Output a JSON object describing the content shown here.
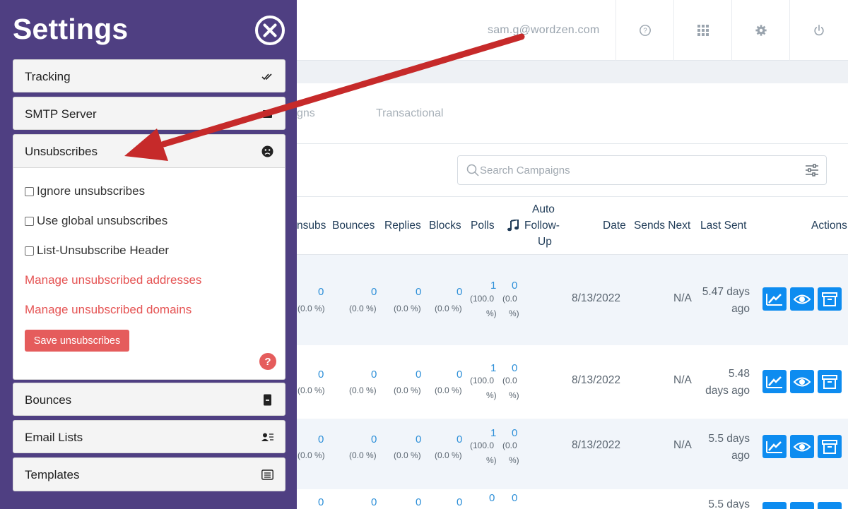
{
  "topbar": {
    "user_email": "sam.g@wordzen.com",
    "icons": [
      "help-icon",
      "apps-grid-icon",
      "gear-icon",
      "power-icon"
    ]
  },
  "tabs": {
    "partial_label": "gns",
    "transactional_label": "Transactional"
  },
  "search": {
    "placeholder": "Search Campaigns"
  },
  "table": {
    "headers": {
      "unsubs": "nsubs",
      "bounces": "Bounces",
      "replies": "Replies",
      "blocks": "Blocks",
      "polls": "Polls",
      "auto_followup_l1": "Auto",
      "auto_followup_l2": "Follow-",
      "auto_followup_l3": "Up",
      "date": "Date",
      "sends_next": "Sends Next",
      "last_sent": "Last Sent",
      "actions": "Actions"
    },
    "rows": [
      {
        "unsubs": "0",
        "unsubs_pct": "(0.0 %)",
        "bounces": "0",
        "bounces_pct": "(0.0 %)",
        "replies": "0",
        "replies_pct": "(0.0 %)",
        "blocks": "0",
        "blocks_pct": "(0.0 %)",
        "polls": "1",
        "polls_pct_l1": "(100.0",
        "polls_pct_l2": "%)",
        "followup": "0",
        "followup_pct_l1": "(0.0",
        "followup_pct_l2": "%)",
        "date": "8/13/2022",
        "sends_next": "N/A",
        "last_sent_l1": "5.47 days",
        "last_sent_l2": "ago"
      },
      {
        "unsubs": "0",
        "unsubs_pct": "(0.0 %)",
        "bounces": "0",
        "bounces_pct": "(0.0 %)",
        "replies": "0",
        "replies_pct": "(0.0 %)",
        "blocks": "0",
        "blocks_pct": "(0.0 %)",
        "polls": "1",
        "polls_pct_l1": "(100.0",
        "polls_pct_l2": "%)",
        "followup": "0",
        "followup_pct_l1": "(0.0",
        "followup_pct_l2": "%)",
        "date": "8/13/2022",
        "sends_next": "N/A",
        "last_sent_l1": "5.48",
        "last_sent_l2": "days ago"
      },
      {
        "unsubs": "0",
        "unsubs_pct": "(0.0 %)",
        "bounces": "0",
        "bounces_pct": "(0.0 %)",
        "replies": "0",
        "replies_pct": "(0.0 %)",
        "blocks": "0",
        "blocks_pct": "(0.0 %)",
        "polls": "1",
        "polls_pct_l1": "(100.0",
        "polls_pct_l2": "%)",
        "followup": "0",
        "followup_pct_l1": "(0.0",
        "followup_pct_l2": "%)",
        "date": "8/13/2022",
        "sends_next": "N/A",
        "last_sent_l1": "5.5 days",
        "last_sent_l2": "ago"
      },
      {
        "unsubs": "0",
        "bounces": "0",
        "replies": "0",
        "blocks": "0",
        "polls": "0",
        "followup": "0",
        "last_sent_l1": "5.5 days"
      }
    ]
  },
  "settings": {
    "title": "Settings",
    "sections": {
      "tracking": {
        "label": "Tracking",
        "icon": "double-check-icon"
      },
      "smtp": {
        "label": "SMTP Server",
        "icon": "server-icon"
      },
      "unsubscribes": {
        "label": "Unsubscribes",
        "icon": "frown-icon"
      },
      "bounces": {
        "label": "Bounces",
        "icon": "phone-icon"
      },
      "email_lists": {
        "label": "Email Lists",
        "icon": "contacts-icon"
      },
      "templates": {
        "label": "Templates",
        "icon": "template-icon"
      }
    },
    "unsubscribes_body": {
      "ignore_label": "Ignore unsubscribes",
      "global_label": "Use global unsubscribes",
      "header_label": "List-Unsubscribe Header",
      "manage_addresses": "Manage unsubscribed addresses",
      "manage_domains": "Manage unsubscribed domains",
      "save_label": "Save unsubscribes",
      "help_label": "?"
    }
  },
  "colors": {
    "panel_bg": "#4f3f82",
    "link_red": "#e55353",
    "action_blue": "#0d8cf0",
    "number_blue": "#2d8fd8",
    "arrow_red": "#c62a2a"
  }
}
